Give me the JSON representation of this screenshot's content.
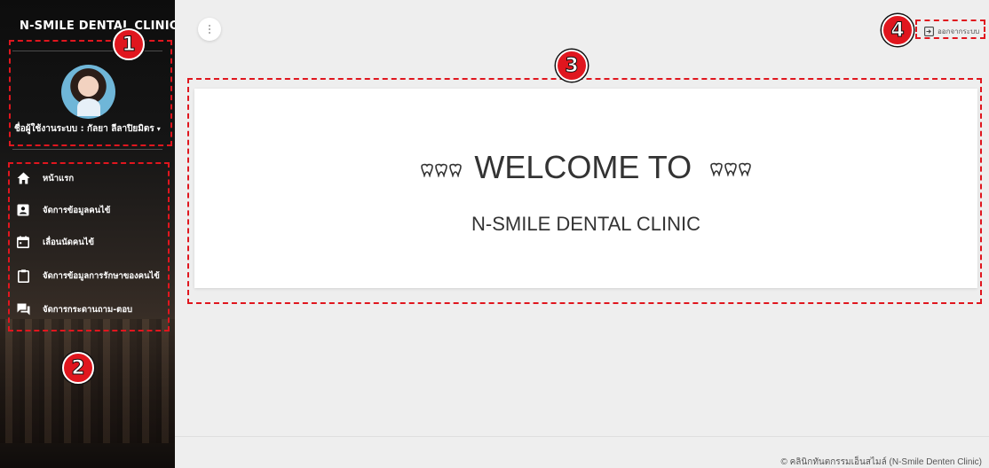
{
  "sidebar": {
    "brand": "N-SMILE DENTAL CLINIC",
    "user_label": "ชื่อผู้ใช้งานระบบ : กัลยา ลีลาปิยมิตร",
    "caret": "▾",
    "items": [
      {
        "label": "หน้าแรก",
        "icon": "home-icon"
      },
      {
        "label": "จัดการข้อมูลคนไข้",
        "icon": "id-card-icon"
      },
      {
        "label": "เลื่อนนัดคนไข้",
        "icon": "calendar-icon"
      },
      {
        "label": "จัดการข้อมูลการรักษาของคนไข้",
        "icon": "clipboard-icon"
      },
      {
        "label": "จัดการกระดานถาม-ตอบ",
        "icon": "forum-icon"
      }
    ]
  },
  "header": {
    "menu_toggle_icon": "more-vert-icon",
    "logout_label": "ออกจากระบบ",
    "logout_icon": "exit-icon"
  },
  "main": {
    "welcome_text": "WELCOME TO",
    "ornament": "ᾛ7",
    "clinic_name": "N-SMILE DENTAL CLINIC"
  },
  "footer": {
    "copyright": "© คลินิกทันตกรรมเอ็นสไมล์ (N-Smile Denten Clinic)"
  },
  "annotations": {
    "markers": [
      "1",
      "2",
      "3",
      "4"
    ],
    "color": "#e0161e"
  }
}
